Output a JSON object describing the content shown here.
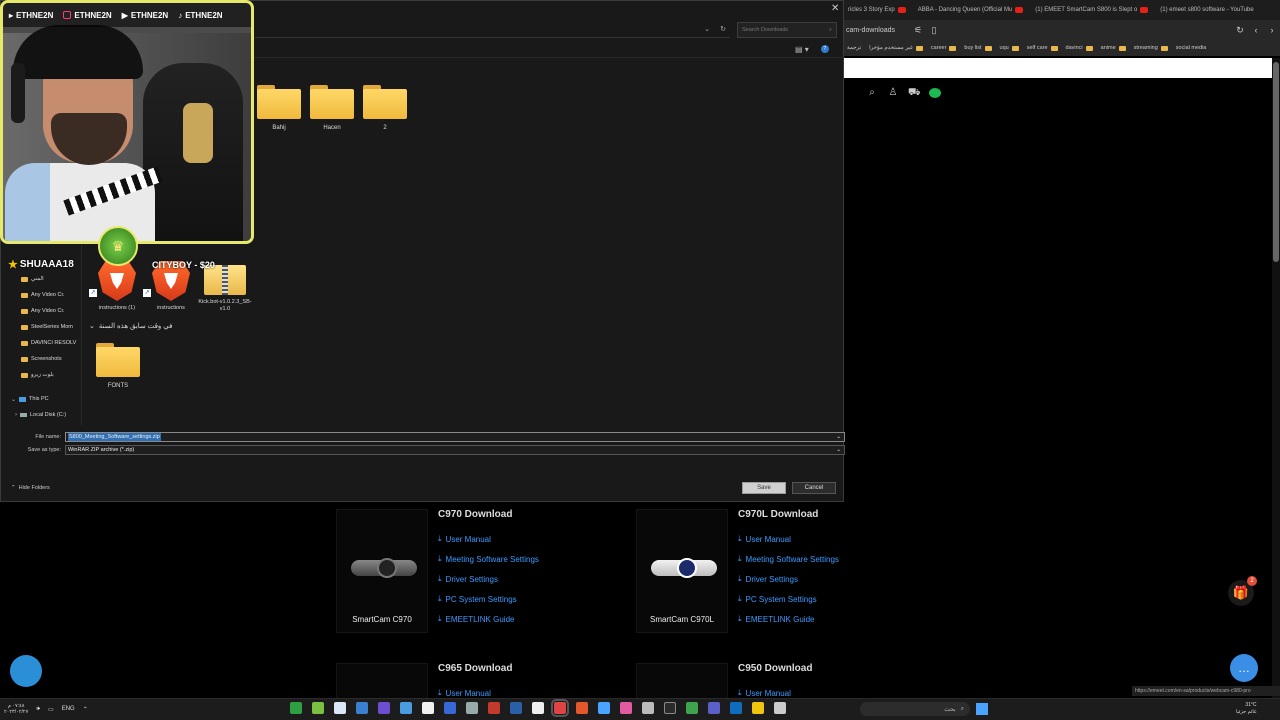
{
  "browser": {
    "tabs": [
      {
        "label": "ricles 3 Story Exp",
        "icon": "youtube-icon"
      },
      {
        "label": "ABBA - Dancing Queen (Official Mu",
        "icon": "youtube-icon"
      },
      {
        "label": "(1) EMEET SmartCam S800 is Slept o",
        "icon": "youtube-icon"
      },
      {
        "label": "(1) emeet s800 software - YouTube",
        "icon": "youtube-icon"
      }
    ],
    "url_fragment": "cam-downloads",
    "bookmarks": [
      "ترجمة",
      "غير مستخدم مؤخرا",
      "career",
      "buy list",
      "uqu",
      "self care",
      "davinci",
      "anime",
      "streaming",
      "social media"
    ],
    "status_url": "https://emeet.com/en-sa/products/webcam-c980-pro"
  },
  "products": [
    {
      "title": "C970 Download",
      "caption": "SmartCam C970",
      "links": [
        "User Manual",
        "Meeting Software Settings",
        "Driver Settings",
        "PC System Settings",
        "EMEETLINK Guide"
      ]
    },
    {
      "title": "C970L Download",
      "caption": "SmartCam C970L",
      "links": [
        "User Manual",
        "Meeting Software Settings",
        "Driver Settings",
        "PC System Settings",
        "EMEETLINK Guide"
      ]
    },
    {
      "title": "C965 Download",
      "links": [
        "User Manual"
      ]
    },
    {
      "title": "C950 Download",
      "links": [
        "User Manual"
      ]
    }
  ],
  "gift_badge": "2",
  "dialog": {
    "search_placeholder": "Search Downloads",
    "folders": [
      "Bahij",
      "Hacen",
      "2"
    ],
    "files": [
      {
        "label": "instructions (1)",
        "kind": "brave-shortcut"
      },
      {
        "label": "instructions",
        "kind": "brave-shortcut"
      },
      {
        "label": "Kick.bot-v1.0.2.3_SB-v1.0",
        "kind": "zip"
      }
    ],
    "group_header": "في وقت سابق هذه السنة",
    "group_folders": [
      "FONTS"
    ],
    "nav_items": [
      {
        "label": "المني",
        "kind": "folder"
      },
      {
        "label": "Any Video Cr.",
        "kind": "folder"
      },
      {
        "label": "Any Video Cr.",
        "kind": "folder"
      },
      {
        "label": "SteelSeries Mom",
        "kind": "folder"
      },
      {
        "label": "DAVINCI RESOLV",
        "kind": "folder"
      },
      {
        "label": "Screenshots",
        "kind": "folder"
      },
      {
        "label": "بلوت زيرو",
        "kind": "folder"
      }
    ],
    "this_pc": "This PC",
    "local_disk": "Local Disk (C:)",
    "file_name_label": "File name:",
    "file_name_value": "S800_Meeting_Software_settings.zip",
    "save_type_label": "Save as type:",
    "save_type_value": "WinRAR ZIP archive (*.zip)",
    "hide_folders": "Hide Folders",
    "save_button": "Save",
    "cancel_button": "Cancel"
  },
  "overlay": {
    "handle": "ETHNE2N",
    "handles": [
      "ETHNE2N",
      "ETHNE2N",
      "ETHNE2N",
      "ETHNE2N"
    ],
    "viewer_name": "SHUAAA18",
    "viewer_name2": "CITYBOY - $20"
  },
  "taskbar": {
    "time": "٠٧:٤٨ م",
    "date": "٢٠٢٣/٠٢/٢٧",
    "lang": "ENG",
    "search_text": "بحث",
    "temperature": "31°C",
    "weather": "غائم جزئيا"
  }
}
